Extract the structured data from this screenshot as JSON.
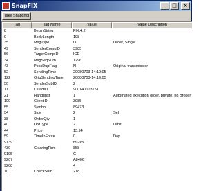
{
  "window": {
    "title": "SnapFIX",
    "min_glyph": "_",
    "max_glyph": "□",
    "close_glyph": "×"
  },
  "toolbar": {
    "snapshot_label": "Take Snapshot"
  },
  "table": {
    "headers": {
      "tag": "Tag",
      "tag_name": "Tag Name",
      "value": "Value",
      "value_description": "Value Description"
    },
    "rows": [
      {
        "tag": "8",
        "tag_name": "BeginString",
        "value": "FIX.4.2",
        "desc": ""
      },
      {
        "tag": "9",
        "tag_name": "BodyLength",
        "value": "198",
        "desc": ""
      },
      {
        "tag": "35",
        "tag_name": "MsgType",
        "value": "D",
        "desc": "Order, Single"
      },
      {
        "tag": "49",
        "tag_name": "SenderCompID",
        "value": "3985",
        "desc": ""
      },
      {
        "tag": "56",
        "tag_name": "TargetCompID",
        "value": "ICE",
        "desc": ""
      },
      {
        "tag": "34",
        "tag_name": "MsgSeqNum",
        "value": "1296",
        "desc": ""
      },
      {
        "tag": "43",
        "tag_name": "PossDupFlag",
        "value": "N",
        "desc": "Original transmission"
      },
      {
        "tag": "52",
        "tag_name": "SendingTime",
        "value": "20080703-14:19:05",
        "desc": ""
      },
      {
        "tag": "122",
        "tag_name": "OrigSendingTime",
        "value": "20080703-14:19:05",
        "desc": ""
      },
      {
        "tag": "50",
        "tag_name": "SenderSubID",
        "value": "2",
        "desc": ""
      },
      {
        "tag": "11",
        "tag_name": "ClOrdID",
        "value": "900140003151",
        "desc": ""
      },
      {
        "tag": "21",
        "tag_name": "HandlInst",
        "value": "1",
        "desc": "Automated execution order, private, no Broker intervention"
      },
      {
        "tag": "109",
        "tag_name": "ClientID",
        "value": "3985",
        "desc": ""
      },
      {
        "tag": "55",
        "tag_name": "Symbol",
        "value": "89473",
        "desc": ""
      },
      {
        "tag": "54",
        "tag_name": "Side",
        "value": "2",
        "desc": "Sell"
      },
      {
        "tag": "38",
        "tag_name": "OrderQty",
        "value": "1",
        "desc": ""
      },
      {
        "tag": "40",
        "tag_name": "OrdType",
        "value": "2",
        "desc": "Limit"
      },
      {
        "tag": "44",
        "tag_name": "Price",
        "value": "13.94",
        "desc": ""
      },
      {
        "tag": "59",
        "tag_name": "TimeInForce",
        "value": "0",
        "desc": "Day"
      },
      {
        "tag": "9139",
        "tag_name": "",
        "value": "mr-lx5",
        "desc": ""
      },
      {
        "tag": "439",
        "tag_name": "ClearingFirm",
        "value": "858",
        "desc": ""
      },
      {
        "tag": "9195",
        "tag_name": "",
        "value": "C",
        "desc": ""
      },
      {
        "tag": "9207",
        "tag_name": "",
        "value": "A8406",
        "desc": ""
      },
      {
        "tag": "9208",
        "tag_name": "",
        "value": "4",
        "desc": ""
      },
      {
        "tag": "10",
        "tag_name": "CheckSum",
        "value": "218",
        "desc": ""
      }
    ]
  }
}
